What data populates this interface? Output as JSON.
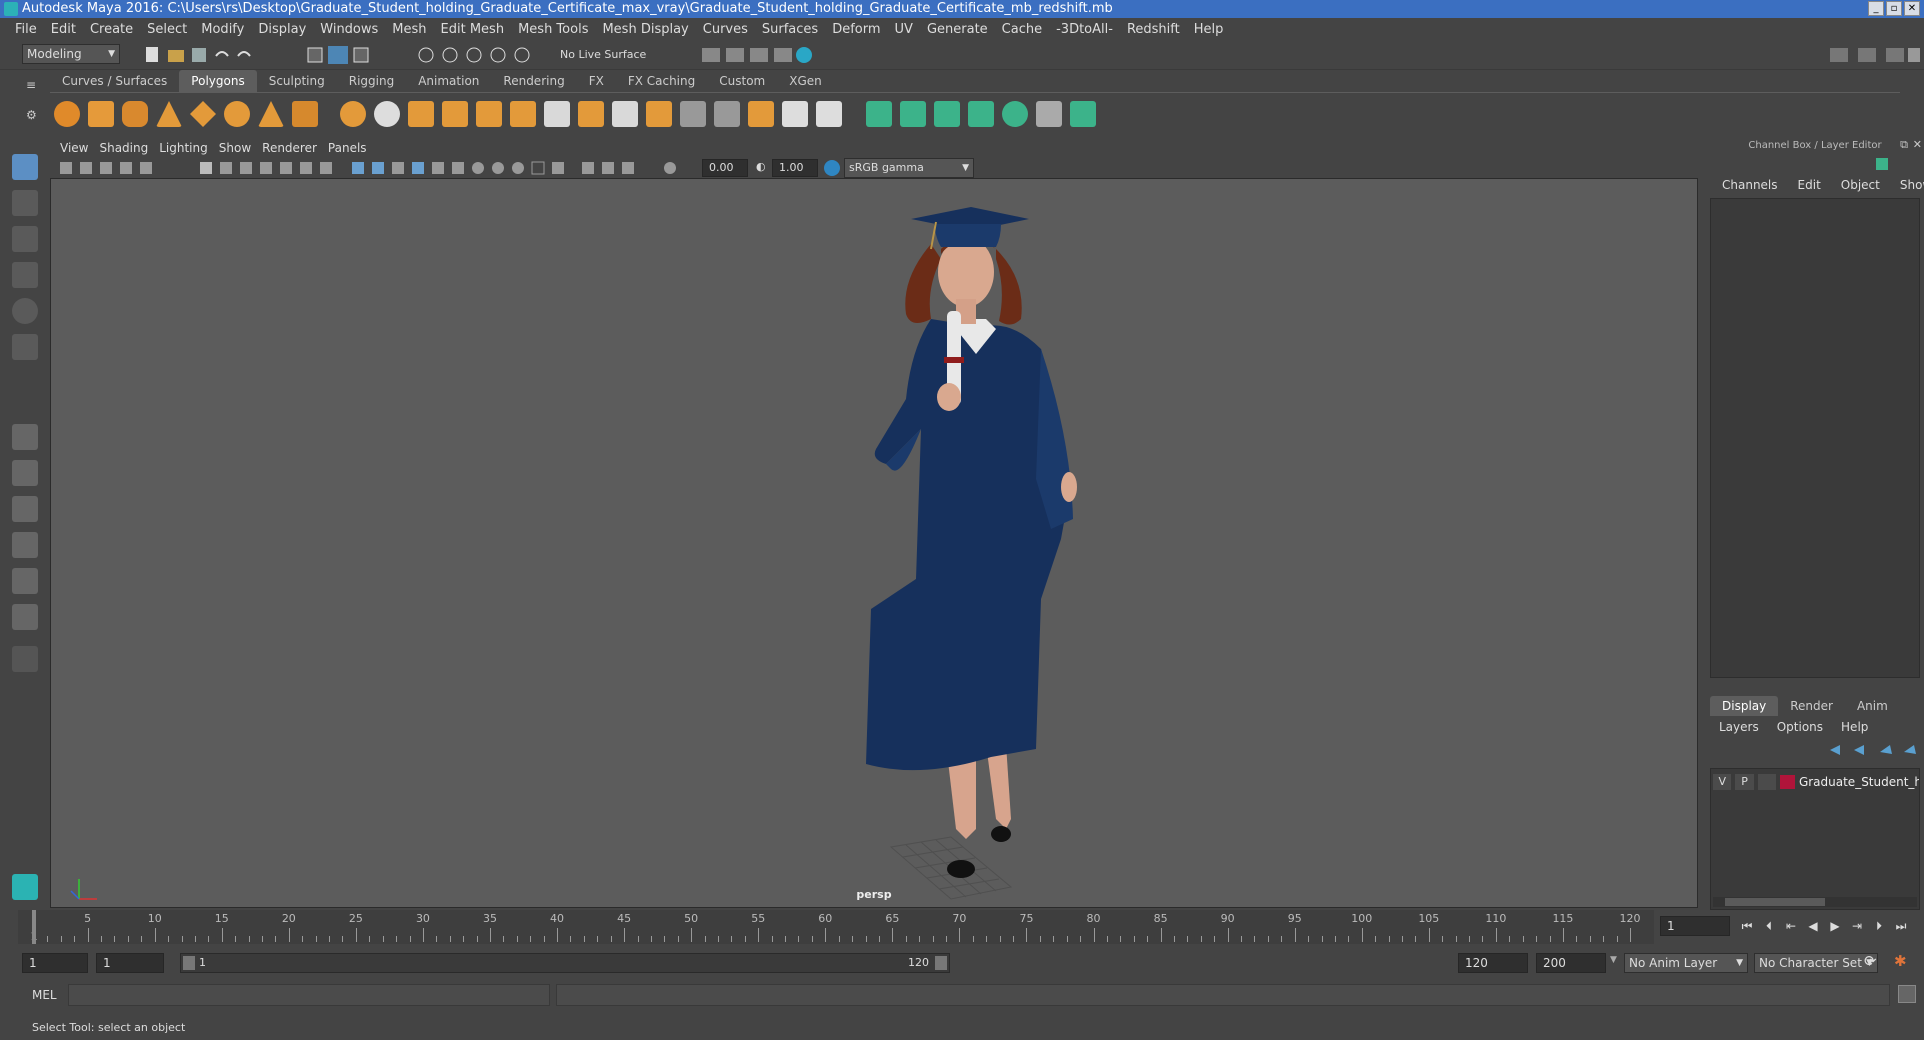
{
  "window": {
    "title": "Autodesk Maya 2016: C:\\Users\\rs\\Desktop\\Graduate_Student_holding_Graduate_Certificate_max_vray\\Graduate_Student_holding_Graduate_Certificate_mb_redshift.mb"
  },
  "menubar": [
    "File",
    "Edit",
    "Create",
    "Select",
    "Modify",
    "Display",
    "Windows",
    "Mesh",
    "Edit Mesh",
    "Mesh Tools",
    "Mesh Display",
    "Curves",
    "Surfaces",
    "Deform",
    "UV",
    "Generate",
    "Cache",
    "-3DtoAll-",
    "Redshift",
    "Help"
  ],
  "status": {
    "mode": "Modeling",
    "live_surface": "No Live Surface"
  },
  "shelf": {
    "tabs": [
      "Curves / Surfaces",
      "Polygons",
      "Sculpting",
      "Rigging",
      "Animation",
      "Rendering",
      "FX",
      "FX Caching",
      "Custom",
      "XGen"
    ],
    "active": "Polygons"
  },
  "viewport": {
    "menu": [
      "View",
      "Shading",
      "Lighting",
      "Show",
      "Renderer",
      "Panels"
    ],
    "exposure": "0.00",
    "gamma": "1.00",
    "color_space": "sRGB gamma",
    "camera": "persp"
  },
  "channel_box": {
    "title": "Channel Box / Layer Editor",
    "menu": [
      "Channels",
      "Edit",
      "Object",
      "Show"
    ]
  },
  "layer_editor": {
    "tabs": [
      "Display",
      "Render",
      "Anim"
    ],
    "active": "Display",
    "menu": [
      "Layers",
      "Options",
      "Help"
    ],
    "layer": {
      "v": "V",
      "p": "P",
      "name": "Graduate_Student_ho",
      "color": "#b0143a"
    }
  },
  "timeline": {
    "ticks": [
      "5",
      "10",
      "15",
      "20",
      "25",
      "30",
      "35",
      "40",
      "45",
      "50",
      "55",
      "60",
      "65",
      "70",
      "75",
      "80",
      "85",
      "90",
      "95",
      "100",
      "105",
      "110",
      "115",
      "120"
    ],
    "start_tick": "1",
    "current_frame": "1"
  },
  "range": {
    "start": "1",
    "playback_start": "1",
    "slider_start": "1",
    "slider_end": "120",
    "playback_end": "120",
    "end": "200",
    "anim_layer": "No Anim Layer",
    "char_set": "No Character Set"
  },
  "cmdline": {
    "label": "MEL"
  },
  "helpline": {
    "text": "Select Tool: select an object"
  }
}
